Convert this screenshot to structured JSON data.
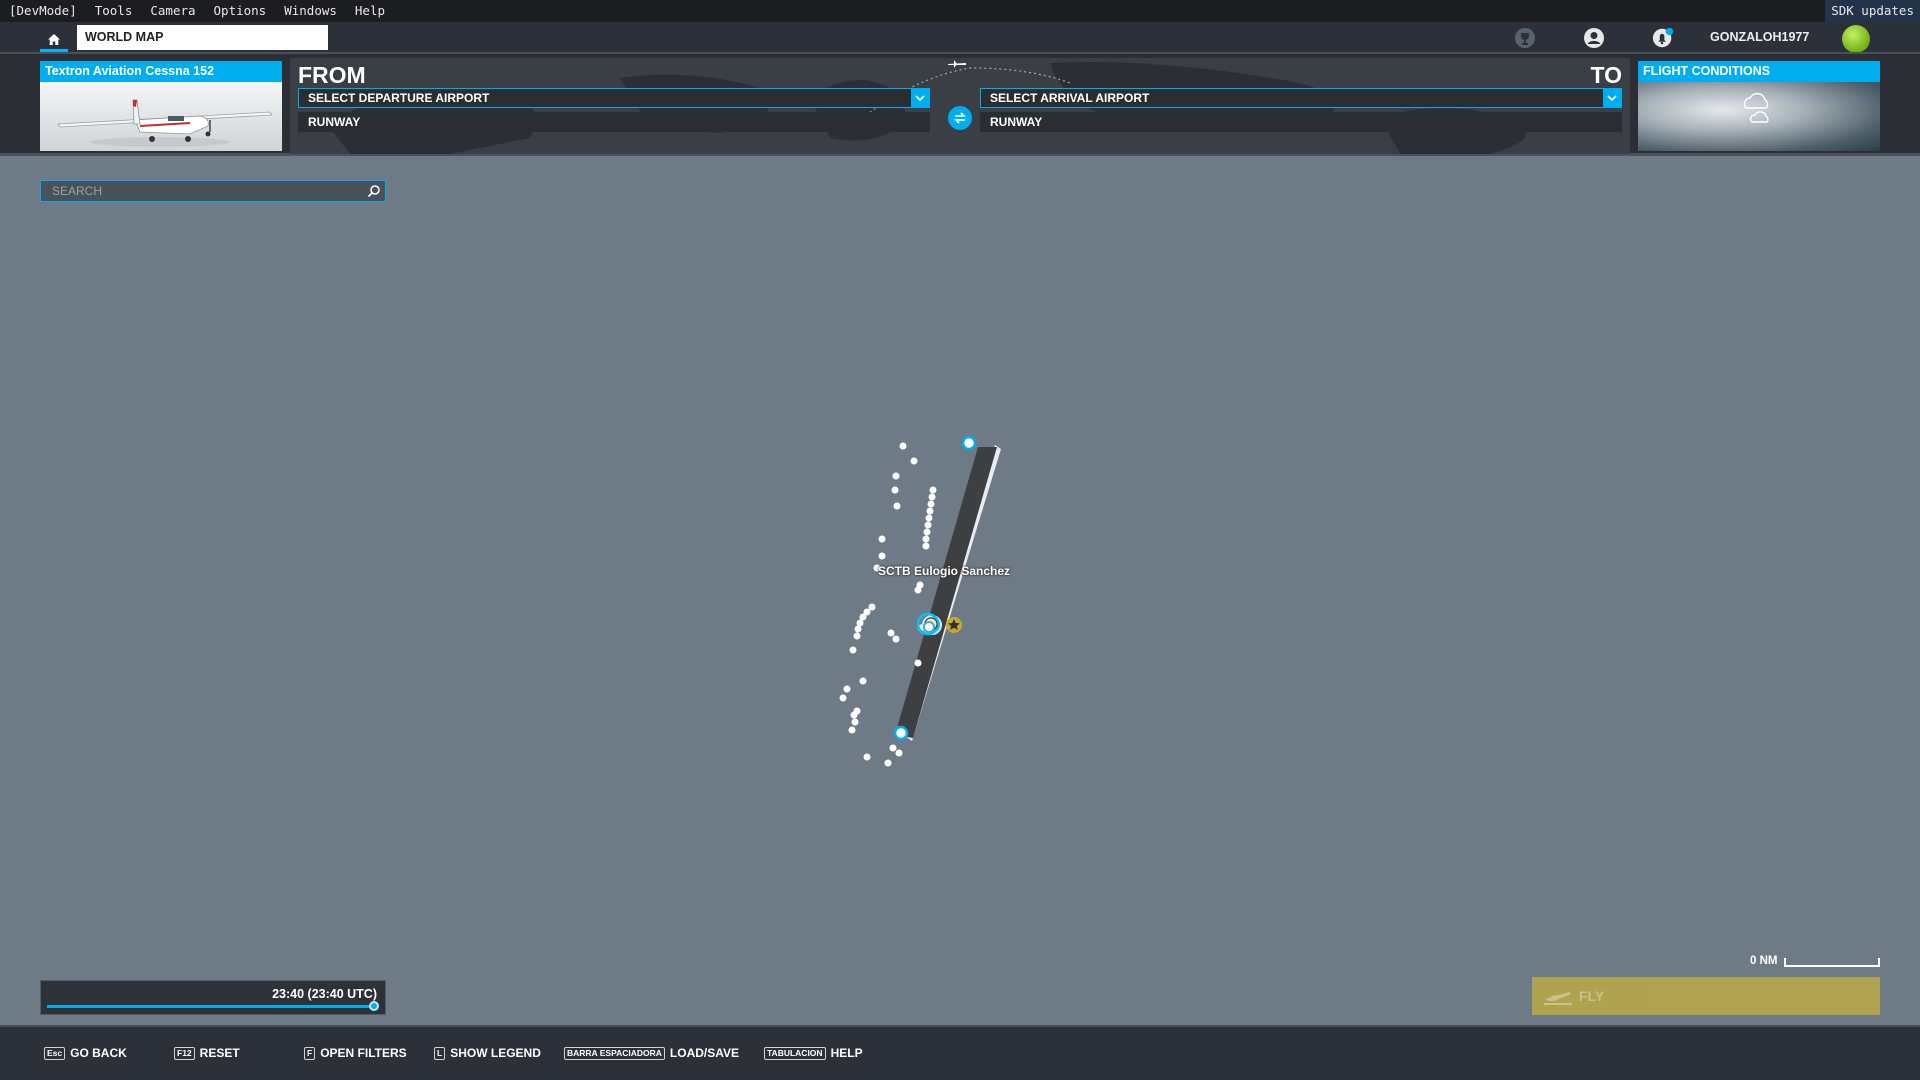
{
  "devbar": {
    "menus": [
      "[DevMode]",
      "Tools",
      "Camera",
      "Options",
      "Windows",
      "Help"
    ],
    "sdk_label": "SDK updates"
  },
  "topnav": {
    "home_icon": "home-icon",
    "tab_label": "WORLD MAP",
    "icons": [
      "achievements-icon",
      "profile-icon",
      "notifications-icon"
    ],
    "username": "GONZALOH1977",
    "level_icon": "level-ball-icon"
  },
  "aircraft": {
    "title": "Textron Aviation Cessna 152"
  },
  "route": {
    "from_label": "FROM",
    "to_label": "TO",
    "departure_placeholder": "SELECT DEPARTURE AIRPORT",
    "arrival_placeholder": "SELECT ARRIVAL AIRPORT",
    "departure_runway": "RUNWAY",
    "arrival_runway": "RUNWAY",
    "swap_icon": "swap-icon"
  },
  "conditions": {
    "title": "FLIGHT CONDITIONS",
    "icon": "weather-cloud-icon"
  },
  "search": {
    "placeholder": "SEARCH",
    "value": ""
  },
  "map": {
    "airport_label": "SCTB Eulogio Sanchez",
    "accent": "#00aeef"
  },
  "time": {
    "text": "23:40 (23:40 UTC)",
    "slider_fraction": 1.0
  },
  "scale": {
    "label": "0 NM"
  },
  "fly": {
    "label": "FLY",
    "color": "#b8a84a"
  },
  "hints": [
    {
      "key": "Esc",
      "label": "GO BACK"
    },
    {
      "key": "F12",
      "label": "RESET"
    },
    {
      "key": "F",
      "label": "OPEN FILTERS"
    },
    {
      "key": "L",
      "label": "SHOW LEGEND"
    },
    {
      "key": "BARRA ESPACIADORA",
      "label": "LOAD/SAVE"
    },
    {
      "key": "TABULACION",
      "label": "HELP"
    }
  ]
}
